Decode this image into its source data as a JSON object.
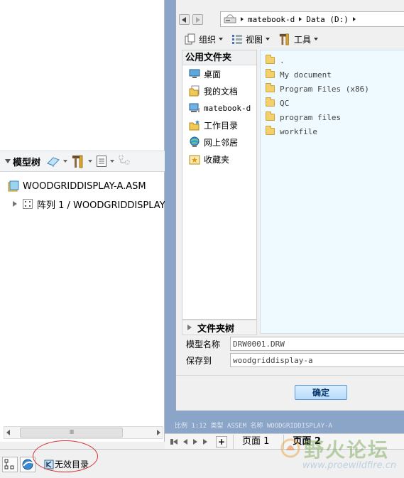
{
  "model_tree": {
    "title": "模型树",
    "items": [
      {
        "label": "WOODGRIDDISPLAY-A.ASM"
      },
      {
        "label": "阵列 1 / WOODGRIDDISPLAY"
      }
    ],
    "scroll_thumb": "IIII"
  },
  "dialog": {
    "breadcrumb": [
      "matebook-d",
      "Data (D:)"
    ],
    "menu": [
      {
        "label": "组织"
      },
      {
        "label": "视图"
      },
      {
        "label": "工具"
      }
    ],
    "favorites_header": "公用文件夹",
    "favorites": [
      {
        "label": "桌面",
        "icon": "desktop-icon"
      },
      {
        "label": "我的文档",
        "icon": "documents-icon"
      },
      {
        "label": "matebook-d",
        "icon": "computer-icon"
      },
      {
        "label": "工作目录",
        "icon": "working-dir-icon"
      },
      {
        "label": "网上邻居",
        "icon": "network-icon"
      },
      {
        "label": "收藏夹",
        "icon": "favorites-icon"
      }
    ],
    "files": [
      ".",
      "My document",
      "Program Files (x86)",
      "QC",
      "program files",
      "workfile"
    ],
    "folder_tree_label": "文件夹树",
    "model_name_label": "模型名称",
    "model_name_value": "DRW0001.DRW",
    "save_to_label": "保存到",
    "save_to_value": "woodgriddisplay-a",
    "ok_label": "确定"
  },
  "status_line": "比例 1:12     类型 ASSEM   名称 WOODGRIDDISPLAY-A",
  "page_tabs": {
    "add_label": "+",
    "tabs": [
      {
        "label": "页面 1"
      },
      {
        "label": "页面 2"
      }
    ]
  },
  "bottom_bar": {
    "invalid_dir_label": "无效目录"
  },
  "watermark": {
    "text": "野火论坛",
    "url": "www.proewildfire.cn"
  },
  "colors": {
    "graphics_bg": "#8aa5c8",
    "file_pane_bg": "#eefaff",
    "ok_button": "#b7dcfb",
    "annotation_red": "#d43030"
  }
}
